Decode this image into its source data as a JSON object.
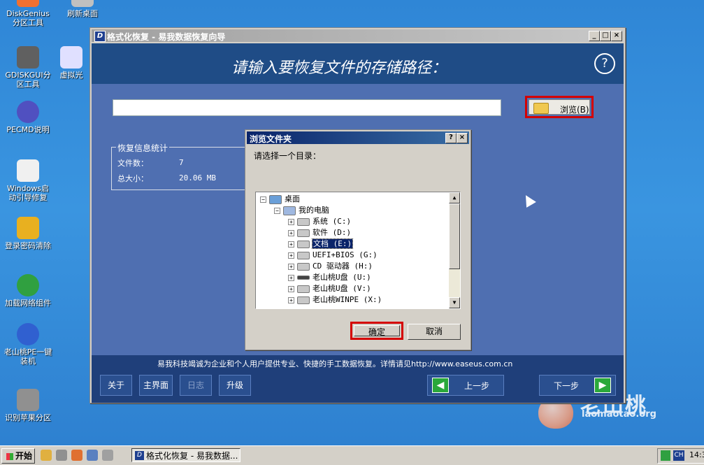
{
  "desktop": {
    "icons": [
      {
        "label": "DiskGenius分区工具",
        "color": "#f07030"
      },
      {
        "label": "刷新桌面",
        "color": "#c0c0c0"
      },
      {
        "label": "GDISKGUI分区工具",
        "color": "#606060"
      },
      {
        "label": "虚拟光",
        "color": "#e0e0ff"
      },
      {
        "label": "PECMD说明",
        "color": "#5050c0"
      },
      {
        "label": "Windows启动引导修复",
        "color": "#f0f0f0"
      },
      {
        "label": "登录密码清除",
        "color": "#e8b020"
      },
      {
        "label": "加载网络组件",
        "color": "#30a040"
      },
      {
        "label": "老山桃PE一键装机",
        "color": "#3060d0"
      },
      {
        "label": "识别苹果分区",
        "color": "#909090"
      }
    ],
    "watermark_text": "老山桃",
    "watermark_url": "laomaotao.org"
  },
  "window": {
    "title": "格式化恢复 - 易我数据恢复向导",
    "icon_letter": "D",
    "min": "_",
    "max": "□",
    "close": "×",
    "prompt": "请输入要恢复文件的存储路径：",
    "help": "?",
    "path_value": "",
    "browse_label": "浏览(B)",
    "stats": {
      "legend": "恢复信息统计",
      "file_count_label": "文件数：",
      "file_count_value": "7",
      "total_size_label": "总大小：",
      "total_size_value": "20.06 MB"
    },
    "ad_text": "易我科技竭诚为企业和个人用户提供专业、快捷的手工数据恢复。详情请见http://www.easeus.com.cn",
    "buttons": {
      "about": "关于",
      "home": "主界面",
      "log": "日志",
      "upgrade": "升级",
      "back": "上一步",
      "next": "下一步"
    }
  },
  "dialog": {
    "title": "浏览文件夹",
    "help": "?",
    "close": "×",
    "prompt": "请选择一个目录：",
    "tree": [
      {
        "label": "桌面",
        "level": 0,
        "expander": "−",
        "kind": "desktop"
      },
      {
        "label": "我的电脑",
        "level": 1,
        "expander": "−",
        "kind": "computer"
      },
      {
        "label": "系统 (C:)",
        "level": 2,
        "expander": "+",
        "kind": "drive"
      },
      {
        "label": "软件 (D:)",
        "level": 2,
        "expander": "+",
        "kind": "drive"
      },
      {
        "label": "文档 (E:)",
        "level": 2,
        "expander": "+",
        "kind": "drive",
        "selected": true
      },
      {
        "label": "UEFI+BIOS (G:)",
        "level": 2,
        "expander": "+",
        "kind": "drive"
      },
      {
        "label": "CD 驱动器 (H:)",
        "level": 2,
        "expander": "+",
        "kind": "cdrom"
      },
      {
        "label": "老山桃U盘 (U:)",
        "level": 2,
        "expander": "+",
        "kind": "usb"
      },
      {
        "label": "老山桃U盘 (V:)",
        "level": 2,
        "expander": "+",
        "kind": "drive"
      },
      {
        "label": "老山桃WINPE (X:)",
        "level": 2,
        "expander": "+",
        "kind": "drive"
      }
    ],
    "ok": "确定",
    "cancel": "取消"
  },
  "taskbar": {
    "start": "开始",
    "task_title": "格式化恢复 - 易我数据...",
    "task_icon_letter": "D",
    "ime": "CH",
    "clock": "14:3"
  }
}
